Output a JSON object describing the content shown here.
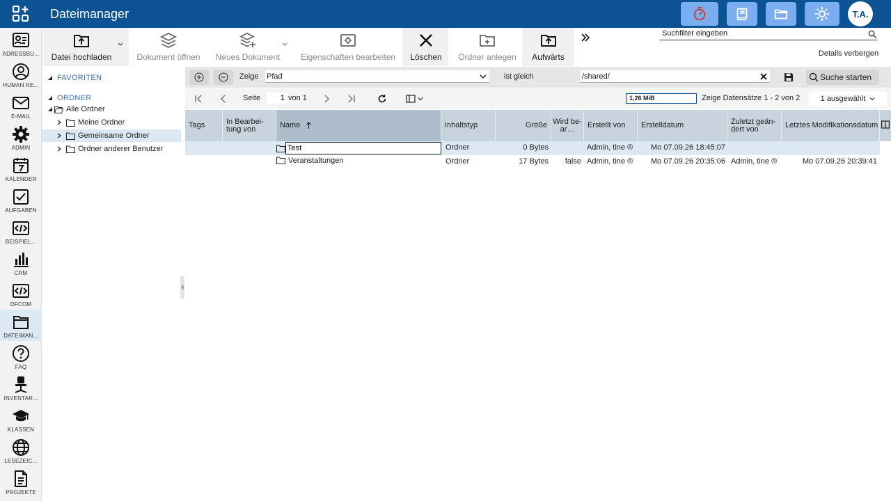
{
  "app": {
    "title": "Dateimanager",
    "user_initials": "T.A."
  },
  "colors": {
    "topbar": "#0b5394",
    "accent": "#7aaef0",
    "selected_row": "#dce8f4"
  },
  "topbar_buttons": [
    {
      "name": "timer-icon"
    },
    {
      "name": "book-icon"
    },
    {
      "name": "folder-icon"
    },
    {
      "name": "sun-icon"
    }
  ],
  "nav": {
    "items": [
      {
        "label": "ADRESSBU...",
        "icon": "address-book-icon"
      },
      {
        "label": "HUMAN RE...",
        "icon": "person-icon"
      },
      {
        "label": "E-MAIL",
        "icon": "mail-icon"
      },
      {
        "label": "ADMIN",
        "icon": "gear-icon"
      },
      {
        "label": "KALENDER",
        "icon": "calendar-icon"
      },
      {
        "label": "AUFGABEN",
        "icon": "checkbox-icon"
      },
      {
        "label": "BEISPIEL...",
        "icon": "code-icon"
      },
      {
        "label": "CRM",
        "icon": "bar-chart-icon"
      },
      {
        "label": "DFCOM",
        "icon": "code-icon"
      },
      {
        "label": "DATEIMAN...",
        "icon": "folder-icon"
      },
      {
        "label": "FAQ",
        "icon": "question-icon"
      },
      {
        "label": "INVENTAR...",
        "icon": "chair-icon"
      },
      {
        "label": "KLASSEN",
        "icon": "graduation-cap-icon"
      },
      {
        "label": "LESEZEIC...",
        "icon": "globe-icon"
      },
      {
        "label": "PROJEKTE",
        "icon": "document-icon"
      }
    ]
  },
  "toolbar": {
    "upload": "Datei hochladen",
    "open": "Dokument öffnen",
    "new_doc": "Neues Dokument",
    "properties": "Eigenschaften bearbeiten",
    "delete": "Löschen",
    "new_folder": "Ordner anlegen",
    "up": "Aufwärts",
    "search_placeholder": "Suchfilter eingeben",
    "details": "Details verbergen"
  },
  "tree": {
    "favorites": "FAVORITEN",
    "folders": "ORDNER",
    "all": "Alle Ordner",
    "children": [
      "Meine Ordner",
      "Gemeinsame Ordner",
      "Ordner anderer Benutzer"
    ]
  },
  "filter": {
    "show": "Zeige",
    "field": "Pfad",
    "operator": "ist gleich",
    "value": "/shared/",
    "search": "Suche starten"
  },
  "paging": {
    "page_label": "Seite",
    "page": "1",
    "of": "von 1",
    "quota": "1,26 MiB",
    "quota_fraction": 0.02,
    "count": "Zeige Datensätze 1 - 2 von 2",
    "selected": "1 ausgewählt"
  },
  "grid": {
    "columns": [
      "Tags",
      "In Bearbei-tung von",
      "Name",
      "Inhaltstyp",
      "Größe",
      "Wird be-ar…",
      "Erstellt von",
      "Erstelldatum",
      "Zuletzt geän-dert von",
      "Letztes Modifikationsdatum"
    ],
    "rows": [
      {
        "name": "Test",
        "type": "Ordner",
        "size": "0 Bytes",
        "editing": "",
        "created_by": "Admin, tine ®",
        "created": "Mo 07.09.26 18:45:07",
        "modified_by": "",
        "modified": ""
      },
      {
        "name": "Veranstaltungen",
        "type": "Ordner",
        "size": "17 Bytes",
        "editing": "false",
        "created_by": "Admin, tine ®",
        "created": "Mo 07.09.26 20:35:06",
        "modified_by": "Admin, tine ®",
        "modified": "Mo 07.09.26 20:39:41"
      }
    ]
  }
}
